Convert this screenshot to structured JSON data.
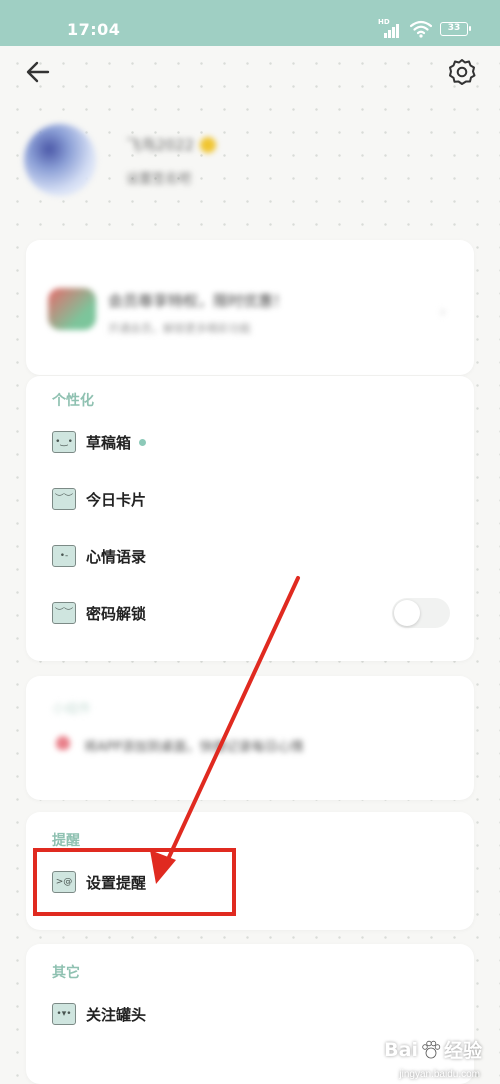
{
  "status_bar": {
    "time": "17:04",
    "network_label": "HD",
    "battery": "33"
  },
  "nav": {
    "back_icon": "arrow-left-icon",
    "settings_icon": "gear-icon"
  },
  "profile": {
    "nickname": "飞鸟2022",
    "subtitle": "设置签名吧"
  },
  "banner": {
    "title": "会员尊享特权，限时优惠！",
    "subtitle": "开通会员，解锁更多精彩功能"
  },
  "personalization": {
    "title": "个性化",
    "items": [
      {
        "label": "草稿箱",
        "icon": "smile-face-icon",
        "face": "•‿•",
        "has_badge": true
      },
      {
        "label": "今日卡片",
        "icon": "squint-face-icon",
        "face": "︶︶",
        "has_badge": false
      },
      {
        "label": "心情语录",
        "icon": "wink-face-icon",
        "face": "•-",
        "has_badge": false
      },
      {
        "label": "密码解锁",
        "icon": "sleepy-face-icon",
        "face": "︶︶",
        "has_badge": false,
        "has_toggle": true,
        "toggle_on": false
      }
    ]
  },
  "blurred_section": {
    "title": "小组件",
    "text": "将APP添加到桌面，快捷记录每日心情"
  },
  "remind": {
    "title": "提醒",
    "item": {
      "label": "设置提醒",
      "icon": "dizzy-face-icon",
      "face": ">@"
    }
  },
  "other": {
    "title": "其它",
    "item": {
      "label": "关注罐头",
      "icon": "grin-face-icon",
      "face": "•▾•"
    }
  },
  "annotation": {
    "color": "#e02a20"
  },
  "watermark": {
    "logo": "Bai",
    "logo_suffix": "经验",
    "url": "jingyan.baidu.com"
  },
  "colors": {
    "status_bar": "#9fcfc3",
    "accent": "#8fc1b1",
    "icon_fill": "#cfe5df"
  }
}
